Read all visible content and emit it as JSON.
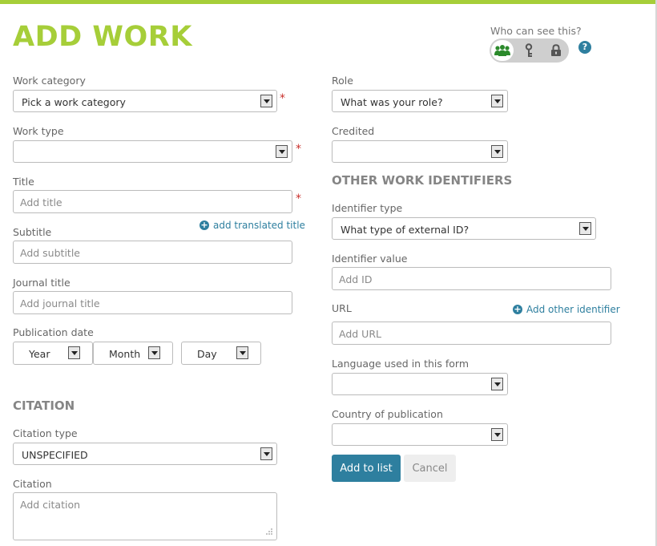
{
  "page": {
    "title": "ADD WORK"
  },
  "visibility": {
    "label": "Who can see this?",
    "help": "?",
    "options": [
      "everyone-icon",
      "key-icon",
      "lock-icon"
    ],
    "selected": "everyone"
  },
  "colors": {
    "brand_green": "#A6CE39",
    "accent_blue": "#2E7F9F",
    "required_red": "#C9302C"
  },
  "left": {
    "work_category": {
      "label": "Work category",
      "value": "Pick a work category",
      "required": "*"
    },
    "work_type": {
      "label": "Work type",
      "value": "",
      "required": "*"
    },
    "title": {
      "label": "Title",
      "placeholder": "Add title",
      "required": "*"
    },
    "add_translated_title": "add translated title",
    "subtitle": {
      "label": "Subtitle",
      "placeholder": "Add subtitle"
    },
    "journal_title": {
      "label": "Journal title",
      "placeholder": "Add journal title"
    },
    "publication_date": {
      "label": "Publication date",
      "year": "Year",
      "month": "Month",
      "day": "Day"
    },
    "citation_section": "CITATION",
    "citation_type": {
      "label": "Citation type",
      "value": "UNSPECIFIED"
    },
    "citation": {
      "label": "Citation",
      "placeholder": "Add citation"
    }
  },
  "right": {
    "role": {
      "label": "Role",
      "value": "What was your role?"
    },
    "credited": {
      "label": "Credited",
      "value": ""
    },
    "other_identifiers_section": "OTHER WORK IDENTIFIERS",
    "identifier_type": {
      "label": "Identifier type",
      "value": "What type of external ID?"
    },
    "identifier_value": {
      "label": "Identifier value",
      "placeholder": "Add ID"
    },
    "url": {
      "label": "URL",
      "placeholder": "Add URL"
    },
    "add_other_identifier": "Add other identifier",
    "language": {
      "label": "Language used in this form",
      "value": ""
    },
    "country": {
      "label": "Country of publication",
      "value": ""
    },
    "add_to_list": "Add to list",
    "cancel": "Cancel"
  }
}
